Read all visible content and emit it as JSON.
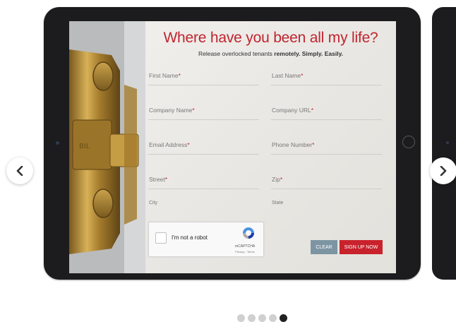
{
  "form": {
    "title": "Where have you been all my life?",
    "subtitle_plain": "Release overlocked tenants ",
    "subtitle_bold": "remotely. Simply. Easily.",
    "required_mark": "*",
    "fields": {
      "first_name": "First Name",
      "last_name": "Last Name",
      "company_name": "Company Name",
      "company_url": "Company URL",
      "email": "Email Address",
      "phone": "Phone Number",
      "street": "Street",
      "zip": "Zip"
    },
    "city_label": "City",
    "state_label": "State",
    "clear_label": "CLEAR",
    "signup_label": "SIGN UP NOW"
  },
  "recaptcha": {
    "text": "I'm not a robot",
    "brand": "reCAPTCHA",
    "links": "Privacy - Terms"
  },
  "carousel": {
    "slide_count": 5,
    "active_index": 4
  },
  "colors": {
    "accent_red": "#c0242f",
    "clear_button": "#7d95a3",
    "device": "#1c1c1e"
  },
  "icons": {
    "prev": "chevron-left-icon",
    "next": "chevron-right-icon",
    "recaptcha": "recaptcha-logo-icon"
  }
}
